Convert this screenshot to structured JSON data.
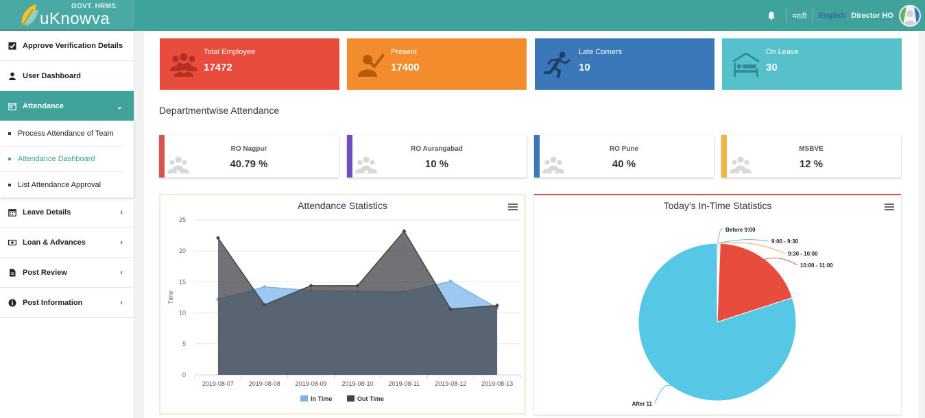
{
  "header": {
    "govt_label": "GOVT. HRMS",
    "app_name": "uKnowva",
    "lang_marathi": "मराठी",
    "lang_english": "English",
    "user_name": "Director HO"
  },
  "sidebar": {
    "items": [
      {
        "label": "Approve Verification Details"
      },
      {
        "label": "User Dashboard"
      },
      {
        "label": "Attendance"
      },
      {
        "label": "Leave Details"
      },
      {
        "label": "Loan & Advances"
      },
      {
        "label": "Post Review"
      },
      {
        "label": "Post Information"
      }
    ],
    "attendance_sub": [
      {
        "label": "Process Attendance of Team"
      },
      {
        "label": "Attendance Dashboard"
      },
      {
        "label": "List Attendance Approval"
      }
    ]
  },
  "stats": [
    {
      "label": "Total Employee",
      "value": "17472",
      "color": "#e84c3d"
    },
    {
      "label": "Present",
      "value": "17400",
      "color": "#f28c2c"
    },
    {
      "label": "Late Comers",
      "value": "10",
      "color": "#3a78b9"
    },
    {
      "label": "On Leave",
      "value": "30",
      "color": "#56c1cb"
    }
  ],
  "dept_section_title": "Departmentwise Attendance",
  "departments": [
    {
      "name": "RO Nagpur",
      "value": "40.79 %",
      "color": "#d9534f"
    },
    {
      "name": "RO Aurangabad",
      "value": "10 %",
      "color": "#6f4fbf"
    },
    {
      "name": "RO Pune",
      "value": "40 %",
      "color": "#3a78b9"
    },
    {
      "name": "MSBVE",
      "value": "12 %",
      "color": "#f0b63f"
    }
  ],
  "chart_data": [
    {
      "type": "area",
      "title": "Attendance Statistics",
      "xlabel": "",
      "ylabel": "Time",
      "ylim": [
        0,
        25
      ],
      "yticks": [
        "0",
        "5",
        "10",
        "15",
        "20",
        "25"
      ],
      "categories": [
        "2019-08-07",
        "2019-08-08",
        "2019-08-09",
        "2019-08-10",
        "2019-08-11",
        "2019-08-12",
        "2019-08-13"
      ],
      "series": [
        {
          "name": "In Time",
          "values": [
            12.2,
            14.2,
            13.6,
            13.5,
            13.4,
            15.1,
            10.8
          ],
          "color": "#7cb5ec"
        },
        {
          "name": "Out Time",
          "values": [
            22.1,
            11.3,
            14.4,
            14.4,
            23.2,
            10.6,
            11.2
          ],
          "color": "#434348"
        }
      ],
      "grid": true,
      "legend": "bottom"
    },
    {
      "type": "pie",
      "title": "Today's In-Time Statistics",
      "slices": [
        {
          "label": "Before 9:00",
          "value": 0.2,
          "color": "#7cb5ec"
        },
        {
          "label": "9:00 - 9:30",
          "value": 0.2,
          "color": "#5bc0be"
        },
        {
          "label": "9:30 - 10:00",
          "value": 0.2,
          "color": "#f7a35c"
        },
        {
          "label": "10:00 - 11:00",
          "value": 19.4,
          "color": "#e84c3d"
        },
        {
          "label": "After 11",
          "value": 80.0,
          "color": "#56c8e6"
        }
      ],
      "legend": "none"
    }
  ]
}
